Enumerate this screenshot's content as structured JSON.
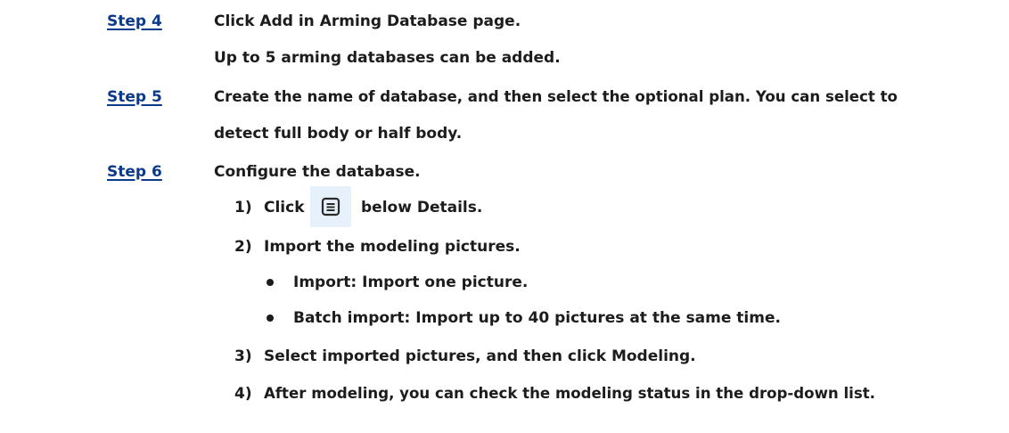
{
  "steps": [
    {
      "label": "Step 4",
      "lines": [
        "Click Add in Arming Database page.",
        "Up to 5 arming databases can be added."
      ]
    },
    {
      "label": "Step 5",
      "lines": [
        "Create the name of database, and then select the optional plan. You can select to",
        "detect full body or half body."
      ]
    },
    {
      "label": "Step 6",
      "lines": [
        "Configure the database."
      ],
      "substeps": [
        {
          "num": "1)",
          "before_icon": "Click",
          "icon": "list-details-icon",
          "after_icon": "below Details."
        },
        {
          "num": "2)",
          "text": "Import the modeling pictures.",
          "bullets": [
            "Import: Import one picture.",
            "Batch import: Import up to 40 pictures at the same time."
          ]
        },
        {
          "num": "3)",
          "text": "Select imported pictures, and then click Modeling."
        },
        {
          "num": "4)",
          "text": "After modeling, you can check the modeling status in the drop-down list."
        }
      ]
    }
  ],
  "colors": {
    "step_label": "#0b3a8a",
    "body_text": "#1c1c1c",
    "icon_bg": "#e7f1fb"
  }
}
